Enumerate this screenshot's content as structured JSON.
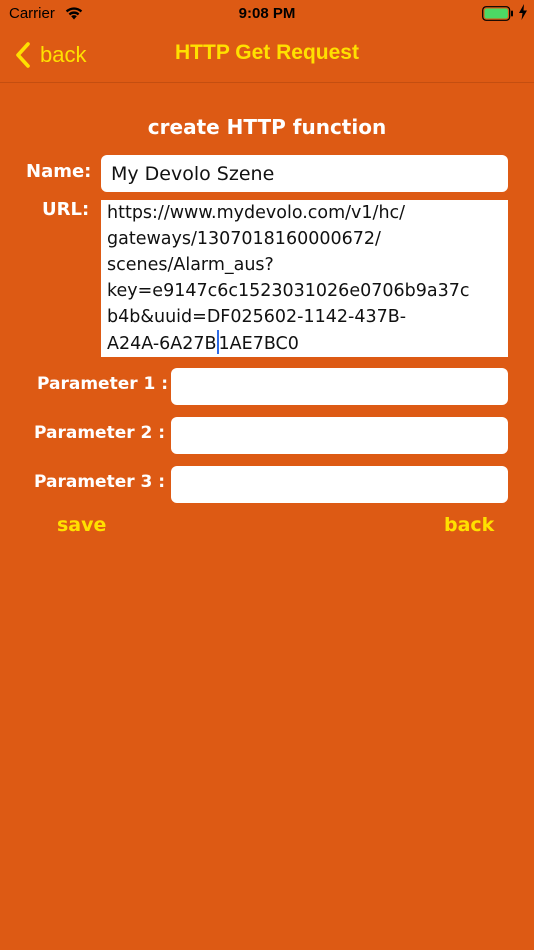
{
  "status_bar": {
    "carrier": "Carrier",
    "time": "9:08 PM"
  },
  "nav": {
    "back_label": "back",
    "title": "HTTP Get Request"
  },
  "form": {
    "section_title": "create HTTP function",
    "name_label": "Name:",
    "name_value": "My Devolo Szene",
    "url_label": "URL:",
    "url_lines": [
      "https://www.mydevolo.com/v1/hc/",
      "gateways/1307018160000672/",
      "scenes/Alarm_aus?",
      "key=e9147c6c1523031026e0706b9a37c",
      "b4b&uuid=DF025602-1142-437B-",
      "A24A-6A27B",
      "1AE7BC0"
    ],
    "param1_label": "Parameter 1 :",
    "param2_label": "Parameter 2 :",
    "param3_label": "Parameter 3 :",
    "param1_value": "",
    "param2_value": "",
    "param3_value": "",
    "save_label": "save",
    "back_label": "back"
  },
  "colors": {
    "background": "#DD5A14",
    "accent": "#FFE000",
    "field": "#FFFFFF",
    "cursor": "#2E6BE6"
  },
  "icons": [
    "wifi-icon",
    "battery-icon",
    "charging-bolt-icon",
    "chevron-left-icon"
  ]
}
